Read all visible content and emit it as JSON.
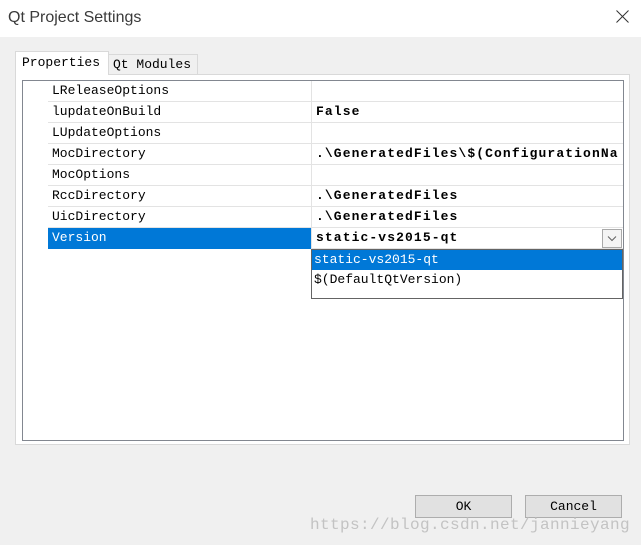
{
  "window": {
    "title": "Qt Project Settings"
  },
  "tabs": [
    {
      "label": "Properties",
      "selected": true
    },
    {
      "label": "Qt Modules",
      "selected": false
    }
  ],
  "properties": [
    {
      "name": "LReleaseOptions"
    },
    {
      "name": "lupdateOnBuild",
      "value": "False"
    },
    {
      "name": "LUpdateOptions"
    },
    {
      "name": "MocDirectory",
      "value": ".\\GeneratedFiles\\$(ConfigurationNa"
    },
    {
      "name": "MocOptions"
    },
    {
      "name": "RccDirectory",
      "value": ".\\GeneratedFiles"
    },
    {
      "name": "UicDirectory",
      "value": ".\\GeneratedFiles"
    },
    {
      "name": "Version",
      "value": "static-vs2015-qt",
      "selected": true
    }
  ],
  "version_dropdown": {
    "expanded": true,
    "selected_index": 0,
    "options": [
      "static-vs2015-qt",
      "$(DefaultQtVersion)"
    ]
  },
  "buttons": {
    "ok": "OK",
    "cancel": "Cancel"
  },
  "watermark": "https://blog.csdn.net/jannieyang",
  "icons": {
    "close": "close-icon",
    "dropdown": "chevron-down-icon"
  },
  "colors": {
    "selection": "#0078d7",
    "selection_text": "#ffffff",
    "button_face": "#e1e1e1",
    "window_background": "#f0f0f0"
  }
}
